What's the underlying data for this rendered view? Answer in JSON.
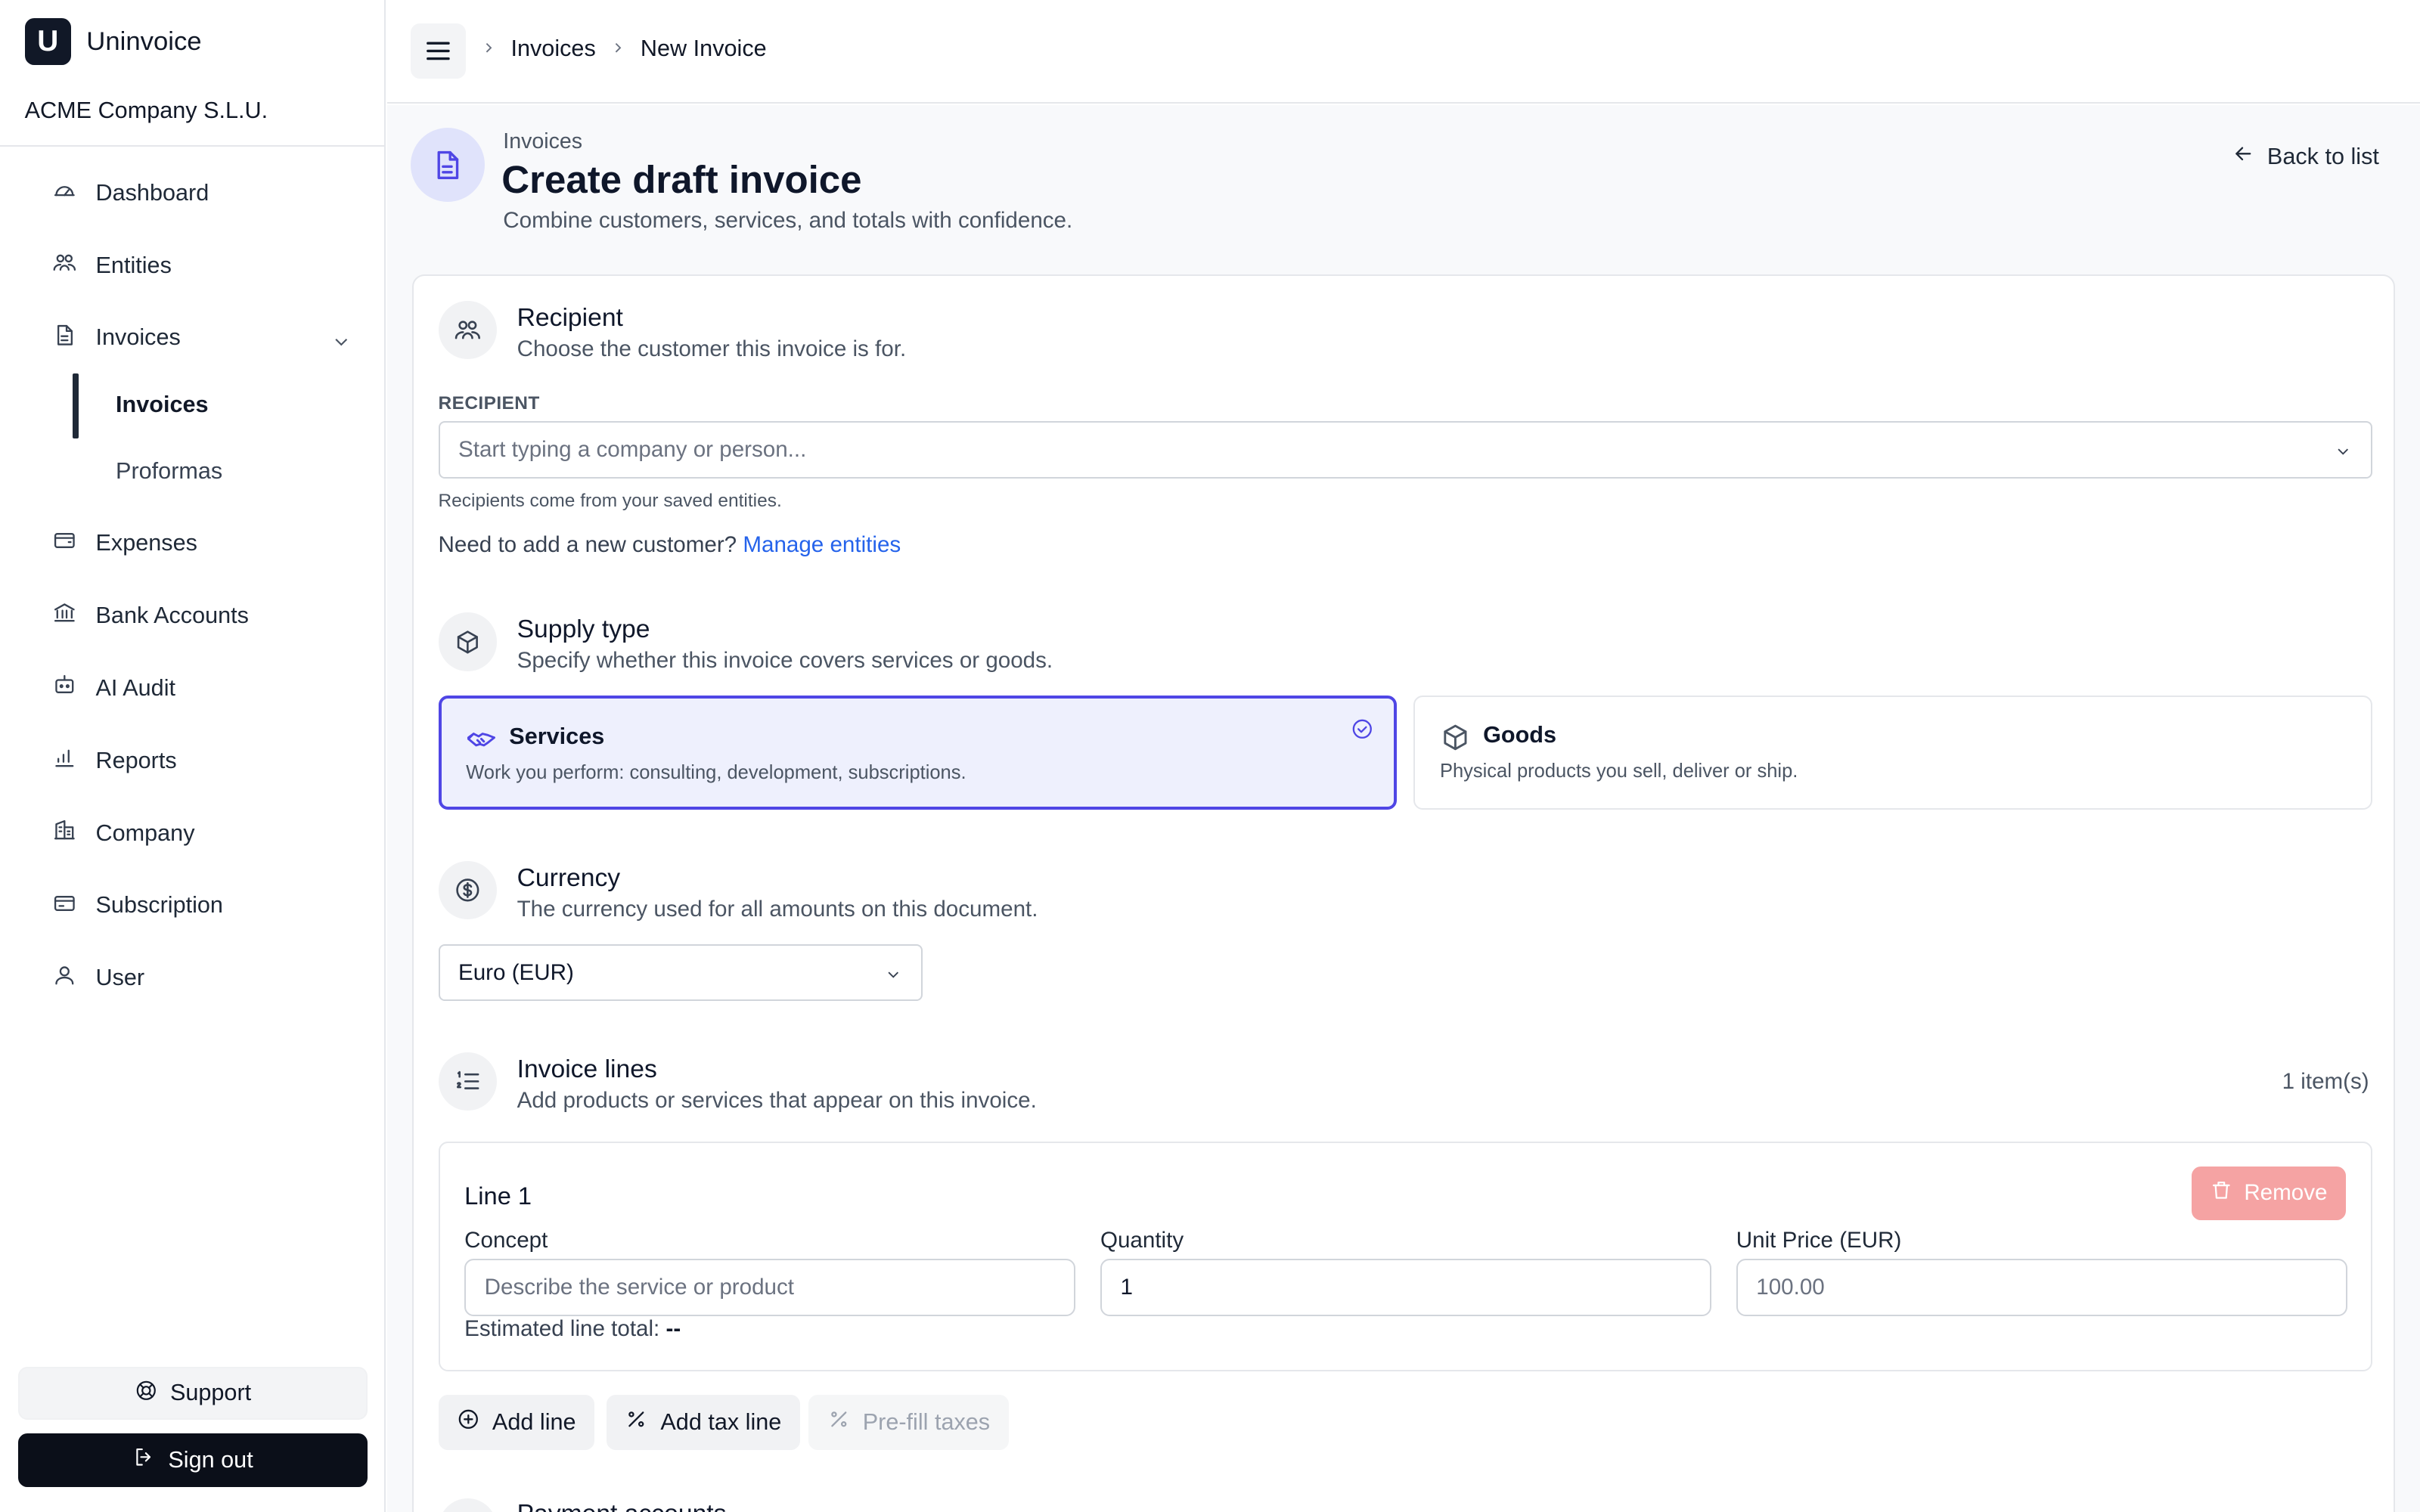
{
  "app": {
    "logo_letter": "U",
    "name": "Uninvoice",
    "company": "ACME Company S.L.U."
  },
  "sidebar": {
    "items": [
      {
        "label": "Dashboard",
        "icon": "gauge-icon"
      },
      {
        "label": "Entities",
        "icon": "users-icon"
      },
      {
        "label": "Invoices",
        "icon": "file-icon"
      },
      {
        "label": "Expenses",
        "icon": "wallet-icon"
      },
      {
        "label": "Bank Accounts",
        "icon": "bank-icon"
      },
      {
        "label": "AI Audit",
        "icon": "robot-icon"
      },
      {
        "label": "Reports",
        "icon": "bar-chart-icon"
      },
      {
        "label": "Company",
        "icon": "building-icon"
      },
      {
        "label": "Subscription",
        "icon": "credit-card-icon"
      },
      {
        "label": "User",
        "icon": "user-icon"
      }
    ],
    "sub_items": [
      {
        "label": "Invoices",
        "active": true
      },
      {
        "label": "Proformas",
        "active": false
      }
    ],
    "support_label": "Support",
    "signout_label": "Sign out"
  },
  "topbar": {
    "breadcrumb": [
      "Invoices",
      "New Invoice"
    ]
  },
  "header": {
    "eyebrow": "Invoices",
    "title": "Create draft invoice",
    "subtitle": "Combine customers, services, and totals with confidence.",
    "back_label": "Back to list"
  },
  "recipient": {
    "title": "Recipient",
    "desc": "Choose the customer this invoice is for.",
    "field_label": "RECIPIENT",
    "placeholder": "Start typing a company or person...",
    "hint": "Recipients come from your saved entities.",
    "help_text": "Need to add a new customer?",
    "help_link": "Manage entities"
  },
  "supply_type": {
    "title": "Supply type",
    "desc": "Specify whether this invoice covers services or goods.",
    "options": [
      {
        "title": "Services",
        "desc": "Work you perform: consulting, development, subscriptions.",
        "selected": true
      },
      {
        "title": "Goods",
        "desc": "Physical products you sell, deliver or ship.",
        "selected": false
      }
    ]
  },
  "currency": {
    "title": "Currency",
    "desc": "The currency used for all amounts on this document.",
    "value": "Euro (EUR)"
  },
  "invoice_lines": {
    "title": "Invoice lines",
    "desc": "Add products or services that appear on this invoice.",
    "count": "1 item(s)",
    "lines": [
      {
        "title": "Line 1",
        "remove_label": "Remove",
        "concept_label": "Concept",
        "concept_placeholder": "Describe the service or product",
        "quantity_label": "Quantity",
        "quantity_value": "1",
        "price_label": "Unit Price (EUR)",
        "price_placeholder": "100.00",
        "total_label": "Estimated line total:",
        "total_value": "--"
      }
    ],
    "actions": {
      "add_line": "Add line",
      "add_tax_line": "Add tax line",
      "prefill_taxes": "Pre-fill taxes"
    }
  },
  "payment": {
    "title": "Payment accounts"
  },
  "colors": {
    "accent": "#4f46e5",
    "link": "#2563eb",
    "danger_disabled": "#f5a3a3",
    "dark": "#0b0f19"
  }
}
